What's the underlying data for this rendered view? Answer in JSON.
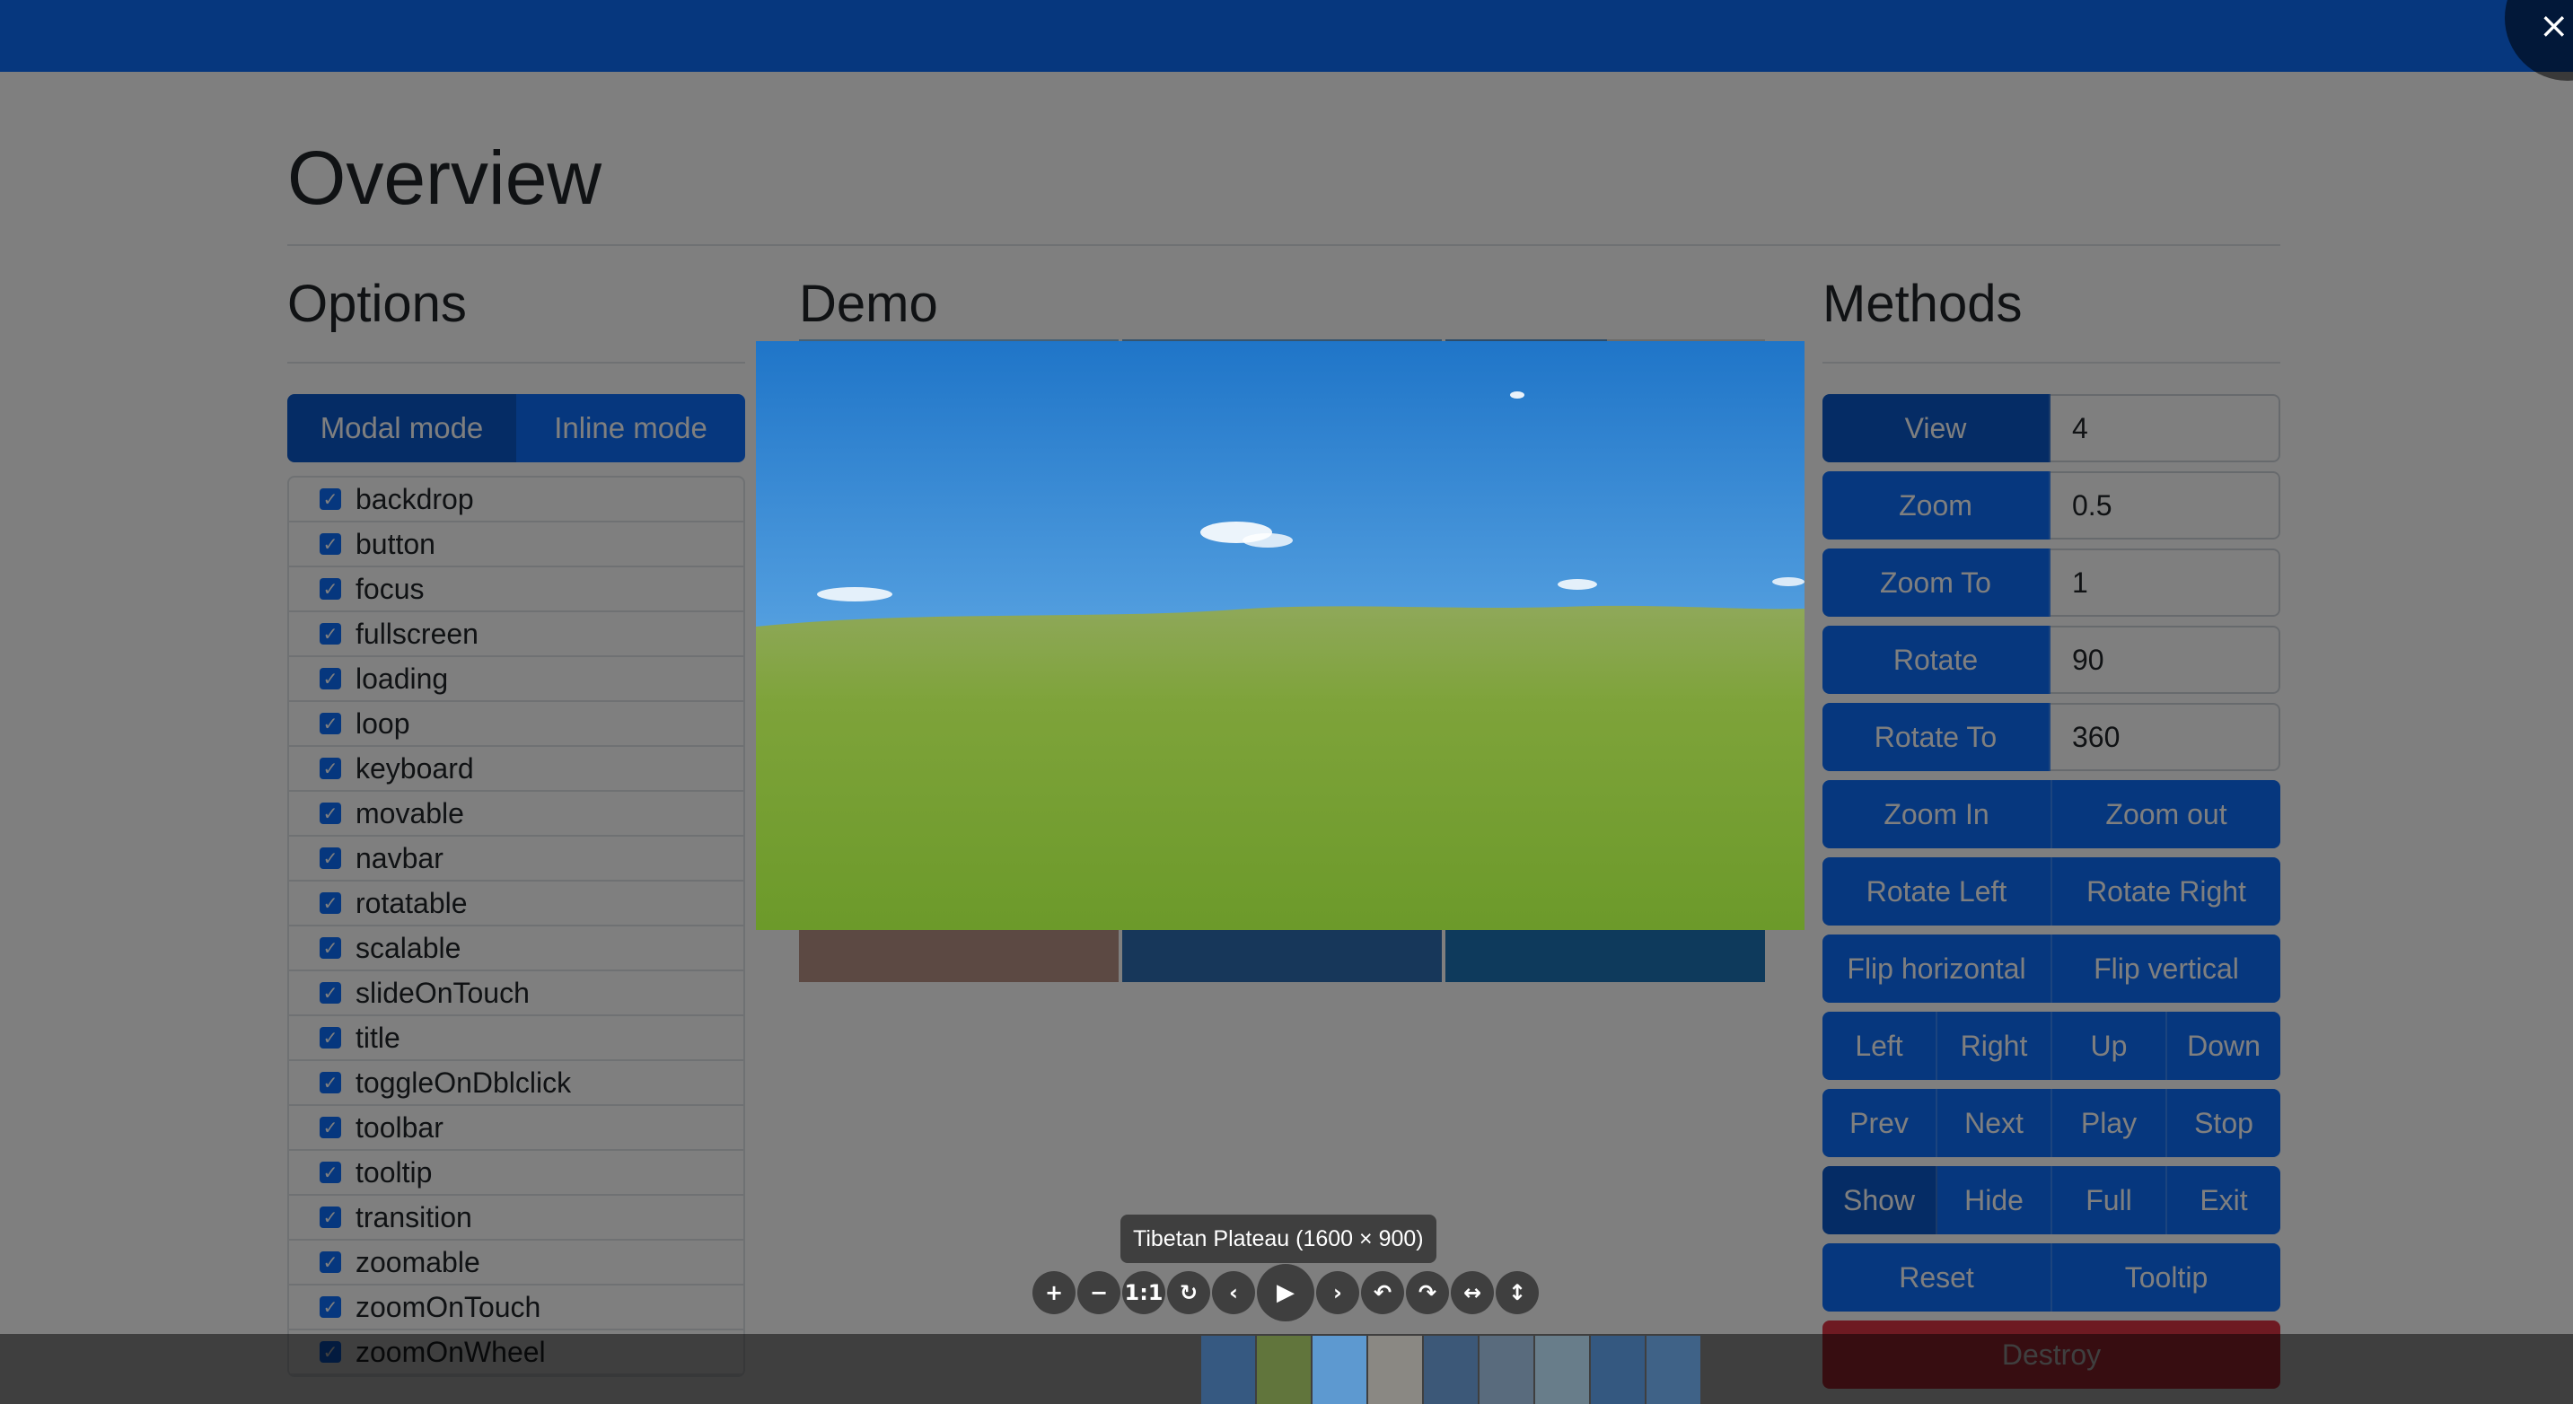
{
  "page": {
    "title": "Overview",
    "options_heading": "Options",
    "demo_heading": "Demo",
    "methods_heading": "Methods"
  },
  "colors": {
    "primary": "#0d6efd",
    "primary_active": "#0a58ca",
    "danger": "#dc3545"
  },
  "options": {
    "modes": [
      "Modal mode",
      "Inline mode"
    ],
    "active_mode": "Modal mode",
    "items": [
      {
        "label": "backdrop",
        "checked": true
      },
      {
        "label": "button",
        "checked": true
      },
      {
        "label": "focus",
        "checked": true
      },
      {
        "label": "fullscreen",
        "checked": true
      },
      {
        "label": "loading",
        "checked": true
      },
      {
        "label": "loop",
        "checked": true
      },
      {
        "label": "keyboard",
        "checked": true
      },
      {
        "label": "movable",
        "checked": true
      },
      {
        "label": "navbar",
        "checked": true
      },
      {
        "label": "rotatable",
        "checked": true
      },
      {
        "label": "scalable",
        "checked": true
      },
      {
        "label": "slideOnTouch",
        "checked": true
      },
      {
        "label": "title",
        "checked": true
      },
      {
        "label": "toggleOnDblclick",
        "checked": true
      },
      {
        "label": "toolbar",
        "checked": true
      },
      {
        "label": "tooltip",
        "checked": true
      },
      {
        "label": "transition",
        "checked": true
      },
      {
        "label": "zoomable",
        "checked": true
      },
      {
        "label": "zoomOnTouch",
        "checked": true
      },
      {
        "label": "zoomOnWheel",
        "checked": true
      }
    ]
  },
  "methods": {
    "view": {
      "label": "View",
      "value": "4"
    },
    "zoom": {
      "label": "Zoom",
      "value": "0.5"
    },
    "zoom_to": {
      "label": "Zoom To",
      "value": "1"
    },
    "rotate": {
      "label": "Rotate",
      "value": "90"
    },
    "rotate_to": {
      "label": "Rotate To",
      "value": "360"
    },
    "zoom_in": "Zoom In",
    "zoom_out": "Zoom out",
    "rotate_left": "Rotate Left",
    "rotate_right": "Rotate Right",
    "flip_horizontal": "Flip horizontal",
    "flip_vertical": "Flip vertical",
    "left": "Left",
    "right": "Right",
    "up": "Up",
    "down": "Down",
    "prev": "Prev",
    "next": "Next",
    "play": "Play",
    "stop": "Stop",
    "show": "Show",
    "hide": "Hide",
    "full": "Full",
    "exit": "Exit",
    "reset": "Reset",
    "tooltip": "Tooltip",
    "destroy": "Destroy"
  },
  "viewer": {
    "title": "Tibetan Plateau (1600 × 900)",
    "close_icon": "×",
    "toolbar": [
      {
        "name": "zoom-in-icon",
        "glyph": "+"
      },
      {
        "name": "zoom-out-icon",
        "glyph": "−"
      },
      {
        "name": "one-to-one-icon",
        "glyph": "1:1"
      },
      {
        "name": "reset-icon",
        "glyph": "↻"
      },
      {
        "name": "prev-icon",
        "glyph": "‹"
      },
      {
        "name": "play-icon",
        "glyph": "▶"
      },
      {
        "name": "next-icon",
        "glyph": "›"
      },
      {
        "name": "rotate-left-icon",
        "glyph": "↶"
      },
      {
        "name": "rotate-right-icon",
        "glyph": "↷"
      },
      {
        "name": "flip-horizontal-icon",
        "glyph": "↔"
      },
      {
        "name": "flip-vertical-icon",
        "glyph": "↕"
      }
    ],
    "active_thumbnail": 2,
    "thumbnail_count": 9
  }
}
